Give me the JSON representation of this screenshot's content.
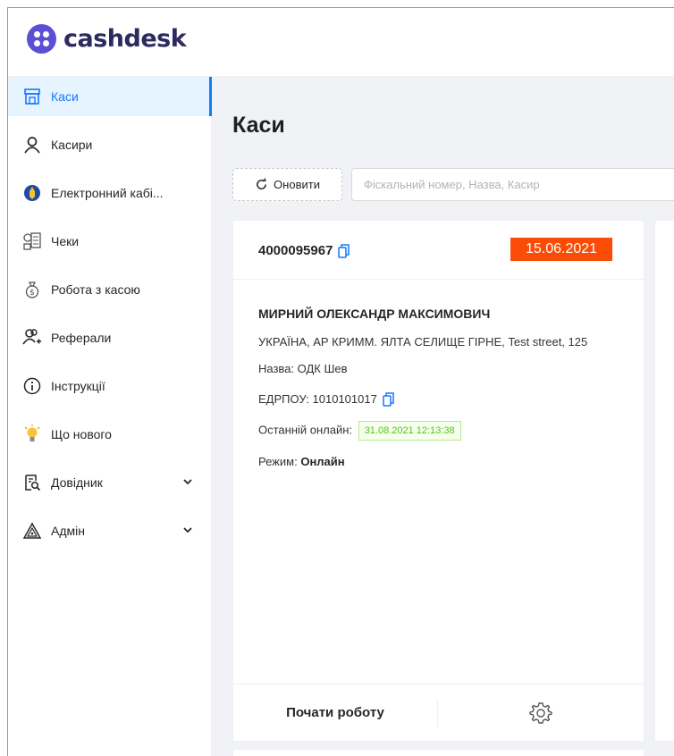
{
  "app": {
    "logo_text_bold": "cash",
    "logo_text_rest": "desk"
  },
  "sidebar": {
    "items": [
      {
        "label": "Каси",
        "icon": "shop-icon",
        "active": true
      },
      {
        "label": "Касири",
        "icon": "user-icon"
      },
      {
        "label": "Електронний кабі...",
        "icon": "ukraine-emblem-icon"
      },
      {
        "label": "Чеки",
        "icon": "receipt-icon"
      },
      {
        "label": "Робота з касою",
        "icon": "money-bag-icon"
      },
      {
        "label": "Реферали",
        "icon": "users-add-icon"
      },
      {
        "label": "Інструкції",
        "icon": "info-icon"
      },
      {
        "label": "Що нового",
        "icon": "bulb-icon"
      },
      {
        "label": "Довідник",
        "icon": "doc-search-icon",
        "expandable": true
      },
      {
        "label": "Адмін",
        "icon": "triangle-icon",
        "expandable": true
      }
    ]
  },
  "main": {
    "title": "Каси",
    "refresh_label": "Оновити",
    "search_placeholder": "Фіскальний номер, Назва, Касир"
  },
  "card": {
    "fiscal_number": "4000095967",
    "date": "15.06.2021",
    "owner": "МИРНИЙ ОЛЕКСАНДР МАКСИМОВИЧ",
    "address": "УКРАЇНА, АР КРИММ. ЯЛТА СЕЛИЩЕ ГІРНЕ, Test street, 125",
    "name_label": "Назва:",
    "name_value": "ОДК Шев",
    "edrpou_label": "ЕДРПОУ:",
    "edrpou_value": "1010101017",
    "last_online_label": "Останній онлайн:",
    "last_online_value": "31.08.2021 12:13:38",
    "mode_label": "Режим:",
    "mode_value": "Онлайн",
    "start_label": "Почати роботу"
  },
  "colors": {
    "accent": "#1677ff",
    "date_badge": "#fa4c06",
    "online_green": "#52c41a"
  }
}
